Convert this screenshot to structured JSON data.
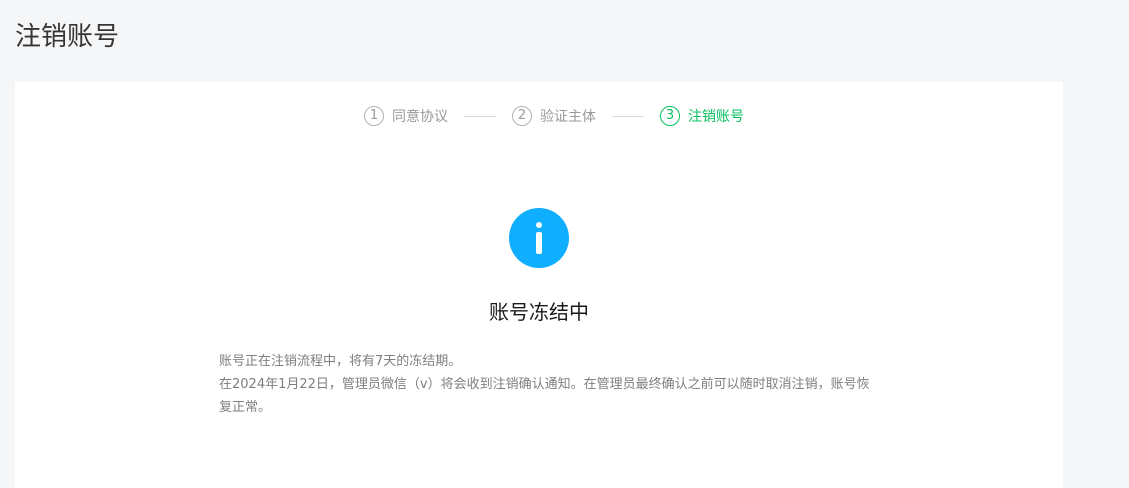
{
  "page": {
    "title": "注销账号"
  },
  "steps": [
    {
      "number": "1",
      "label": "同意协议",
      "state": "done"
    },
    {
      "number": "2",
      "label": "验证主体",
      "state": "done"
    },
    {
      "number": "3",
      "label": "注销账号",
      "state": "active"
    }
  ],
  "status": {
    "icon": "info-icon",
    "icon_color": "#10aeff",
    "title": "账号冻结中",
    "lines": [
      "账号正在注销流程中，将有7天的冻结期。",
      "在2024年1月22日，管理员微信（v）将会收到注销确认通知。在管理员最终确认之前可以随时取消注销，账号恢复正常。"
    ]
  },
  "colors": {
    "accent": "#07c160",
    "muted": "#9a9a9a",
    "background": "#f5f6f7"
  }
}
